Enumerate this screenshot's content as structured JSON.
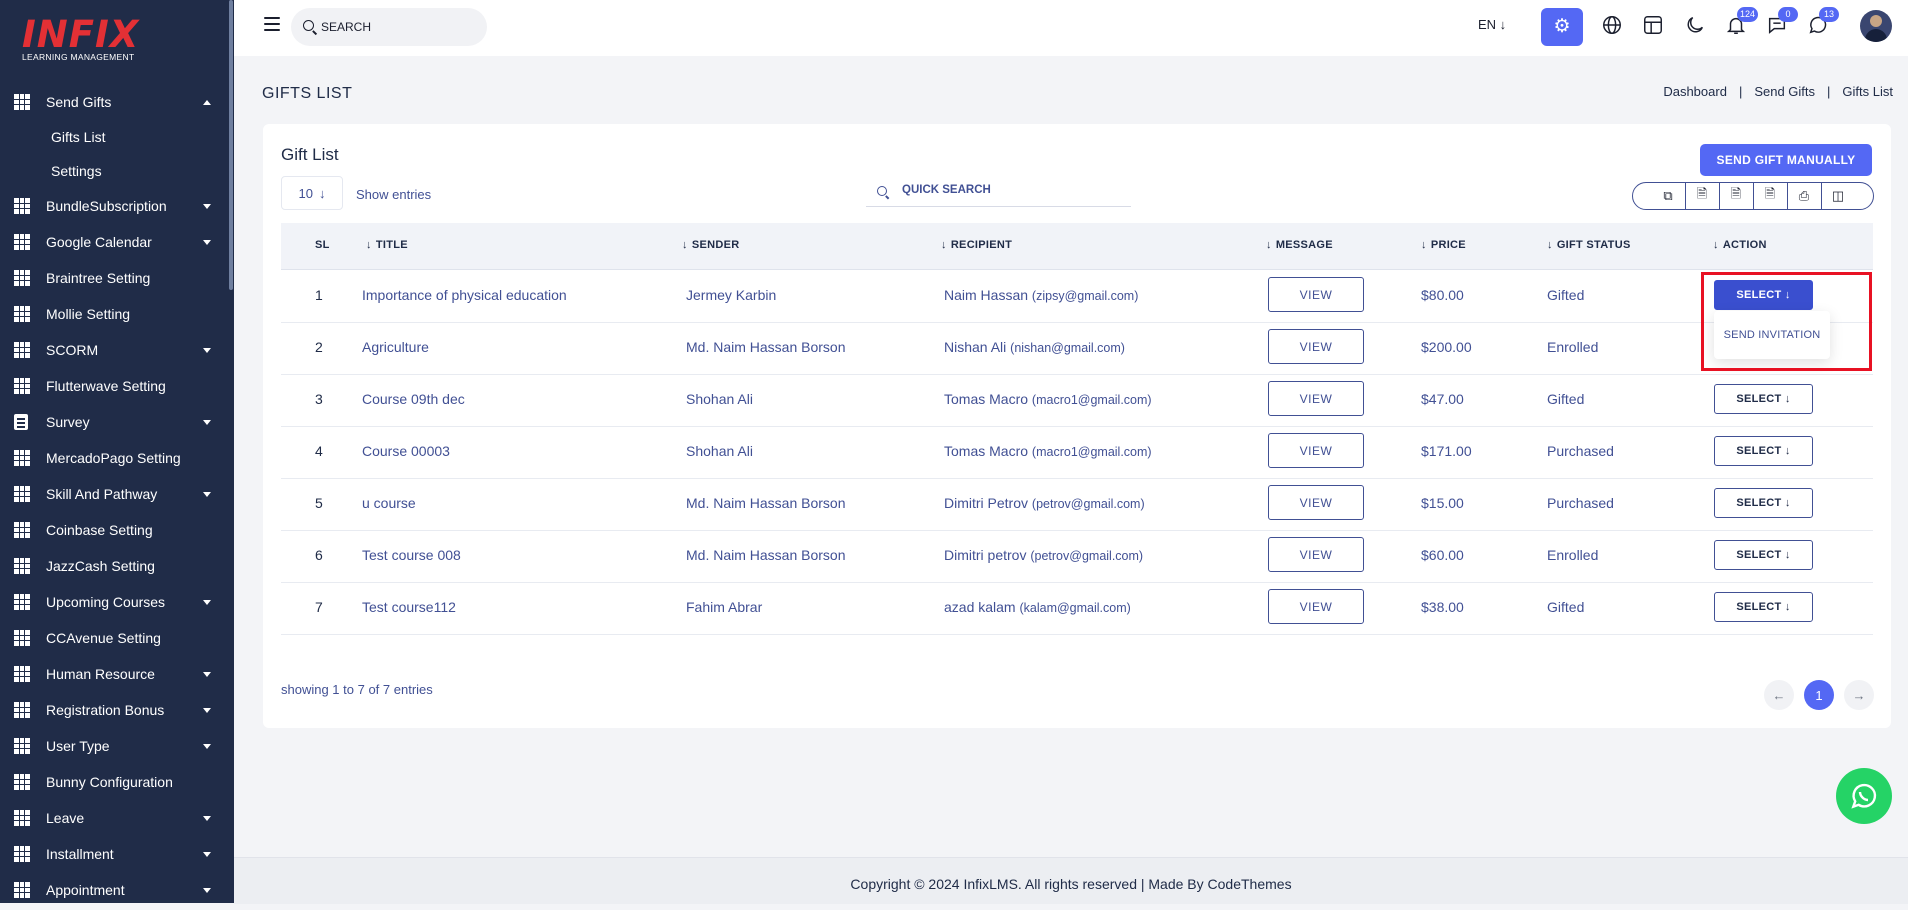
{
  "logo": {
    "main": "INFIX",
    "sub": "LEARNING MANAGEMENT"
  },
  "sidebar": {
    "items": [
      {
        "label": "Send Gifts",
        "icon": "grid-icon",
        "caret": "up",
        "sub": [
          {
            "label": "Gifts List"
          },
          {
            "label": "Settings"
          }
        ]
      },
      {
        "label": "BundleSubscription",
        "icon": "grid-icon",
        "caret": "down"
      },
      {
        "label": "Google Calendar",
        "icon": "grid-icon",
        "caret": "down"
      },
      {
        "label": "Braintree Setting",
        "icon": "grid-icon",
        "caret": ""
      },
      {
        "label": "Mollie Setting",
        "icon": "grid-icon",
        "caret": ""
      },
      {
        "label": "SCORM",
        "icon": "grid-icon",
        "caret": "down"
      },
      {
        "label": "Flutterwave Setting",
        "icon": "grid-icon",
        "caret": ""
      },
      {
        "label": "Survey",
        "icon": "document-icon",
        "caret": "down"
      },
      {
        "label": "MercadoPago Setting",
        "icon": "grid-icon",
        "caret": ""
      },
      {
        "label": "Skill And Pathway",
        "icon": "grid-icon",
        "caret": "down"
      },
      {
        "label": "Coinbase Setting",
        "icon": "grid-icon",
        "caret": ""
      },
      {
        "label": "JazzCash Setting",
        "icon": "grid-icon",
        "caret": ""
      },
      {
        "label": "Upcoming Courses",
        "icon": "grid-icon",
        "caret": "down"
      },
      {
        "label": "CCAvenue Setting",
        "icon": "grid-icon",
        "caret": ""
      },
      {
        "label": "Human Resource",
        "icon": "grid-icon",
        "caret": "down"
      },
      {
        "label": "Registration Bonus",
        "icon": "grid-icon",
        "caret": "down"
      },
      {
        "label": "User Type",
        "icon": "grid-icon",
        "caret": "down"
      },
      {
        "label": "Bunny Configuration",
        "icon": "grid-icon",
        "caret": ""
      },
      {
        "label": "Leave",
        "icon": "grid-icon",
        "caret": "down"
      },
      {
        "label": "Installment",
        "icon": "grid-icon",
        "caret": "down"
      },
      {
        "label": "Appointment",
        "icon": "grid-icon",
        "caret": "down"
      }
    ]
  },
  "topbar": {
    "search_placeholder": "SEARCH",
    "language": "EN ↓",
    "notifications": {
      "bell": "124",
      "messages": "0",
      "whatsapp": "13"
    }
  },
  "page": {
    "title": "GIFTS LIST",
    "breadcrumb": [
      "Dashboard",
      "Send Gifts",
      "Gifts List"
    ]
  },
  "card": {
    "title": "Gift List",
    "send_button": "SEND GIFT MANUALLY",
    "entries_value": "10",
    "entries_label": "Show entries",
    "quick_search_placeholder": "QUICK SEARCH",
    "export_icons": [
      "copy-icon",
      "csv-icon",
      "excel-icon",
      "pdf-icon",
      "print-icon",
      "columns-icon"
    ]
  },
  "table": {
    "headers": {
      "sl": "SL",
      "title": "TITLE",
      "sender": "SENDER",
      "recipient": "RECIPIENT",
      "message": "MESSAGE",
      "price": "PRICE",
      "status": "GIFT STATUS",
      "action": "ACTION"
    },
    "view_label": "VIEW",
    "select_label": "SELECT",
    "rows": [
      {
        "sl": "1",
        "title": "Importance of physical education",
        "sender": "Jermey Karbin",
        "recipient_name": "Naim Hassan",
        "recipient_email": "(zipsy@gmail.com)",
        "price": "$80.00",
        "status": "Gifted"
      },
      {
        "sl": "2",
        "title": "Agriculture",
        "sender": "Md. Naim Hassan Borson",
        "recipient_name": "Nishan Ali",
        "recipient_email": "(nishan@gmail.com)",
        "price": "$200.00",
        "status": "Enrolled"
      },
      {
        "sl": "3",
        "title": "Course 09th dec",
        "sender": "Shohan Ali",
        "recipient_name": "Tomas Macro",
        "recipient_email": "(macro1@gmail.com)",
        "price": "$47.00",
        "status": "Gifted"
      },
      {
        "sl": "4",
        "title": "Course 00003",
        "sender": "Shohan Ali",
        "recipient_name": "Tomas Macro",
        "recipient_email": "(macro1@gmail.com)",
        "price": "$171.00",
        "status": "Purchased"
      },
      {
        "sl": "5",
        "title": "u course",
        "sender": "Md. Naim Hassan Borson",
        "recipient_name": "Dimitri Petrov",
        "recipient_email": "(petrov@gmail.com)",
        "price": "$15.00",
        "status": "Purchased"
      },
      {
        "sl": "6",
        "title": "Test course 008",
        "sender": "Md. Naim Hassan Borson",
        "recipient_name": "Dimitri petrov",
        "recipient_email": "(petrov@gmail.com)",
        "price": "$60.00",
        "status": "Enrolled"
      },
      {
        "sl": "7",
        "title": "Test course112",
        "sender": "Fahim Abrar",
        "recipient_name": "azad kalam",
        "recipient_email": "(kalam@gmail.com)",
        "price": "$38.00",
        "status": "Gifted"
      }
    ],
    "dropdown_item": "SEND INVITATION"
  },
  "pagination": {
    "showing": "showing 1 to 7 of 7 entries",
    "current": "1"
  },
  "footer": {
    "text": "Copyright © 2024 InfixLMS. All rights reserved | Made By CodeThemes"
  },
  "colors": {
    "sidebar_bg": "#202c48",
    "accent": "#5468f4",
    "text": "#415094",
    "highlight": "#e81123",
    "whatsapp": "#25d366"
  }
}
